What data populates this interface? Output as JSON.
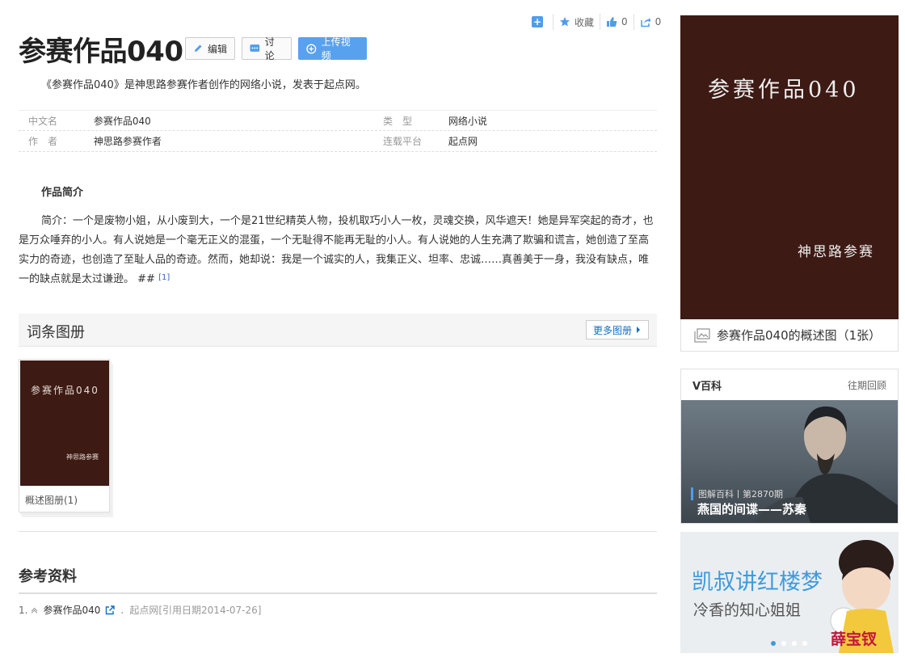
{
  "toolbar": {
    "collect_label": "收藏",
    "like_count": "0",
    "share_count": "0"
  },
  "entry": {
    "title": "参赛作品040",
    "edit_label": "编辑",
    "discuss_label": "讨论",
    "upload_video_label": "上传视频",
    "lead": "《参赛作品040》是神思路参赛作者创作的网络小说，发表于起点网。"
  },
  "basic_info": {
    "rows": [
      {
        "k1": "中文名",
        "v1": "参赛作品040",
        "k2": "类　型",
        "v2": "网络小说"
      },
      {
        "k1": "作　者",
        "v1": "神思路参赛作者",
        "k2": "连载平台",
        "v2": "起点网"
      }
    ]
  },
  "summary": {
    "heading": "作品简介",
    "text": "简介：一个是废物小姐，从小废到大，一个是21世纪精英人物，投机取巧小人一枚，灵魂交换，风华遮天！她是异军突起的奇才，也是万众唾弃的小人。有人说她是一个毫无正义的混蛋，一个无耻得不能再无耻的小人。有人说她的人生充满了欺骗和谎言，她创造了至高实力的奇迹，也创造了至耻人品的奇迹。然而，她却说：我是一个诚实的人，我集正义、坦率、忠诚……真善美于一身，我没有缺点，唯一的缺点就是太过谦逊。 ##",
    "ref_mark": "[1]"
  },
  "gallery": {
    "heading": "词条图册",
    "more_label": "更多图册",
    "card_title": "参赛作品040",
    "card_author": "神思路参赛",
    "card_caption": "概述图册(1)"
  },
  "references": {
    "heading": "参考资料",
    "items": [
      {
        "num": "1.",
        "name": "参赛作品040",
        "source": "．起点网[引用日期2014-07-26]"
      }
    ]
  },
  "sidebar": {
    "cover_title": "参赛作品040",
    "cover_author": "神思路参赛",
    "cover_caption": "参赛作品040的概述图（1张）",
    "vbaike_label": "V百科",
    "vbaike_more": "往期回顾",
    "vbaike_tag": "图解百科丨第2870期",
    "vbaike_title": "燕国的间谍——苏秦",
    "promo_title": "凯叔讲红楼梦",
    "promo_sub": "冷香的知心姐姐",
    "promo_name": "薛宝钗"
  },
  "colors": {
    "accent": "#58a1ee",
    "link": "#136ec2",
    "cover_bg": "#3d1a14"
  }
}
